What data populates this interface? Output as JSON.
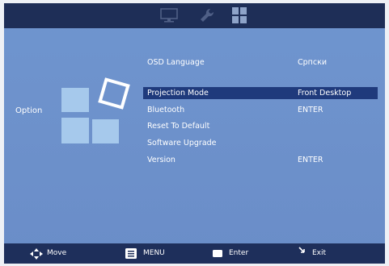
{
  "osd": {
    "section_title": "Option",
    "tabs": [
      {
        "icon": "monitor-icon"
      },
      {
        "icon": "wrench-icon"
      },
      {
        "icon": "option-grid-icon",
        "active": true
      }
    ],
    "menu": [
      {
        "label": "OSD Language",
        "value": "Српски",
        "selected": false
      },
      {
        "label": "Projection Mode",
        "value": "Front Desktop",
        "selected": true
      },
      {
        "label": "Bluetooth",
        "value": "ENTER",
        "selected": false
      },
      {
        "label": "Reset To Default",
        "value": "",
        "selected": false
      },
      {
        "label": "Software Upgrade",
        "value": "",
        "selected": false
      },
      {
        "label": "Version",
        "value": "ENTER",
        "selected": false
      }
    ],
    "hints": [
      {
        "icon": "move-arrows-icon",
        "label": "Move"
      },
      {
        "icon": "menu-icon",
        "label": "MENU"
      },
      {
        "icon": "enter-icon",
        "label": "Enter"
      },
      {
        "icon": "exit-icon",
        "label": "Exit"
      }
    ]
  },
  "colors": {
    "panel": "#6d91cb",
    "bar": "#1e2f5b",
    "selection": "#1f3a7c",
    "tile": "#a6c9ec"
  }
}
